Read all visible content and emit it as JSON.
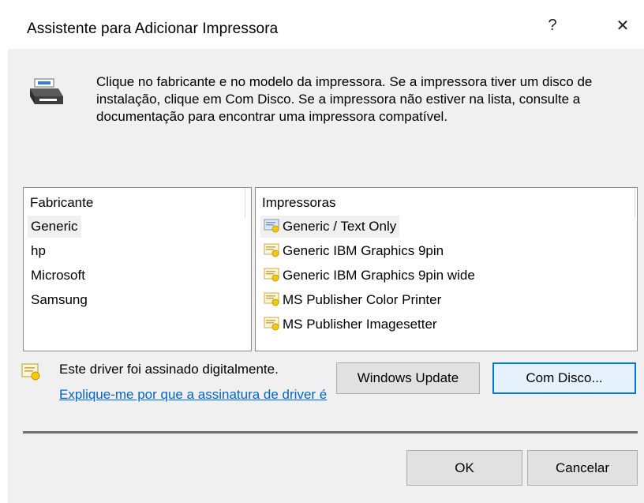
{
  "window": {
    "title": "Assistente para Adicionar Impressora",
    "help_glyph": "?",
    "close_glyph": "✕"
  },
  "description": "Clique no fabricante e no modelo da impressora. Se a impressora tiver um disco de instalação, clique em Com Disco. Se a impressora não estiver na lista, consulte a documentação para encontrar uma impressora compatível.",
  "manufacturers": {
    "header": "Fabricante",
    "items": [
      "Generic",
      "hp",
      "Microsoft",
      "Samsung"
    ],
    "selected": "Generic"
  },
  "printers": {
    "header": "Impressoras",
    "items": [
      "Generic / Text Only",
      "Generic IBM Graphics 9pin",
      "Generic IBM Graphics 9pin wide",
      "MS Publisher Color Printer",
      "MS Publisher Imagesetter"
    ],
    "selected": "Generic / Text Only"
  },
  "signature": {
    "text": "Este driver foi assinado digitalmente.",
    "link": "Explique-me por que a assinatura de driver é"
  },
  "buttons": {
    "windows_update": "Windows Update",
    "have_disk": "Com Disco...",
    "ok": "OK",
    "cancel": "Cancelar"
  },
  "colors": {
    "accent": "#0078d7",
    "link": "#0066cc",
    "certificate": "#f2c811"
  }
}
